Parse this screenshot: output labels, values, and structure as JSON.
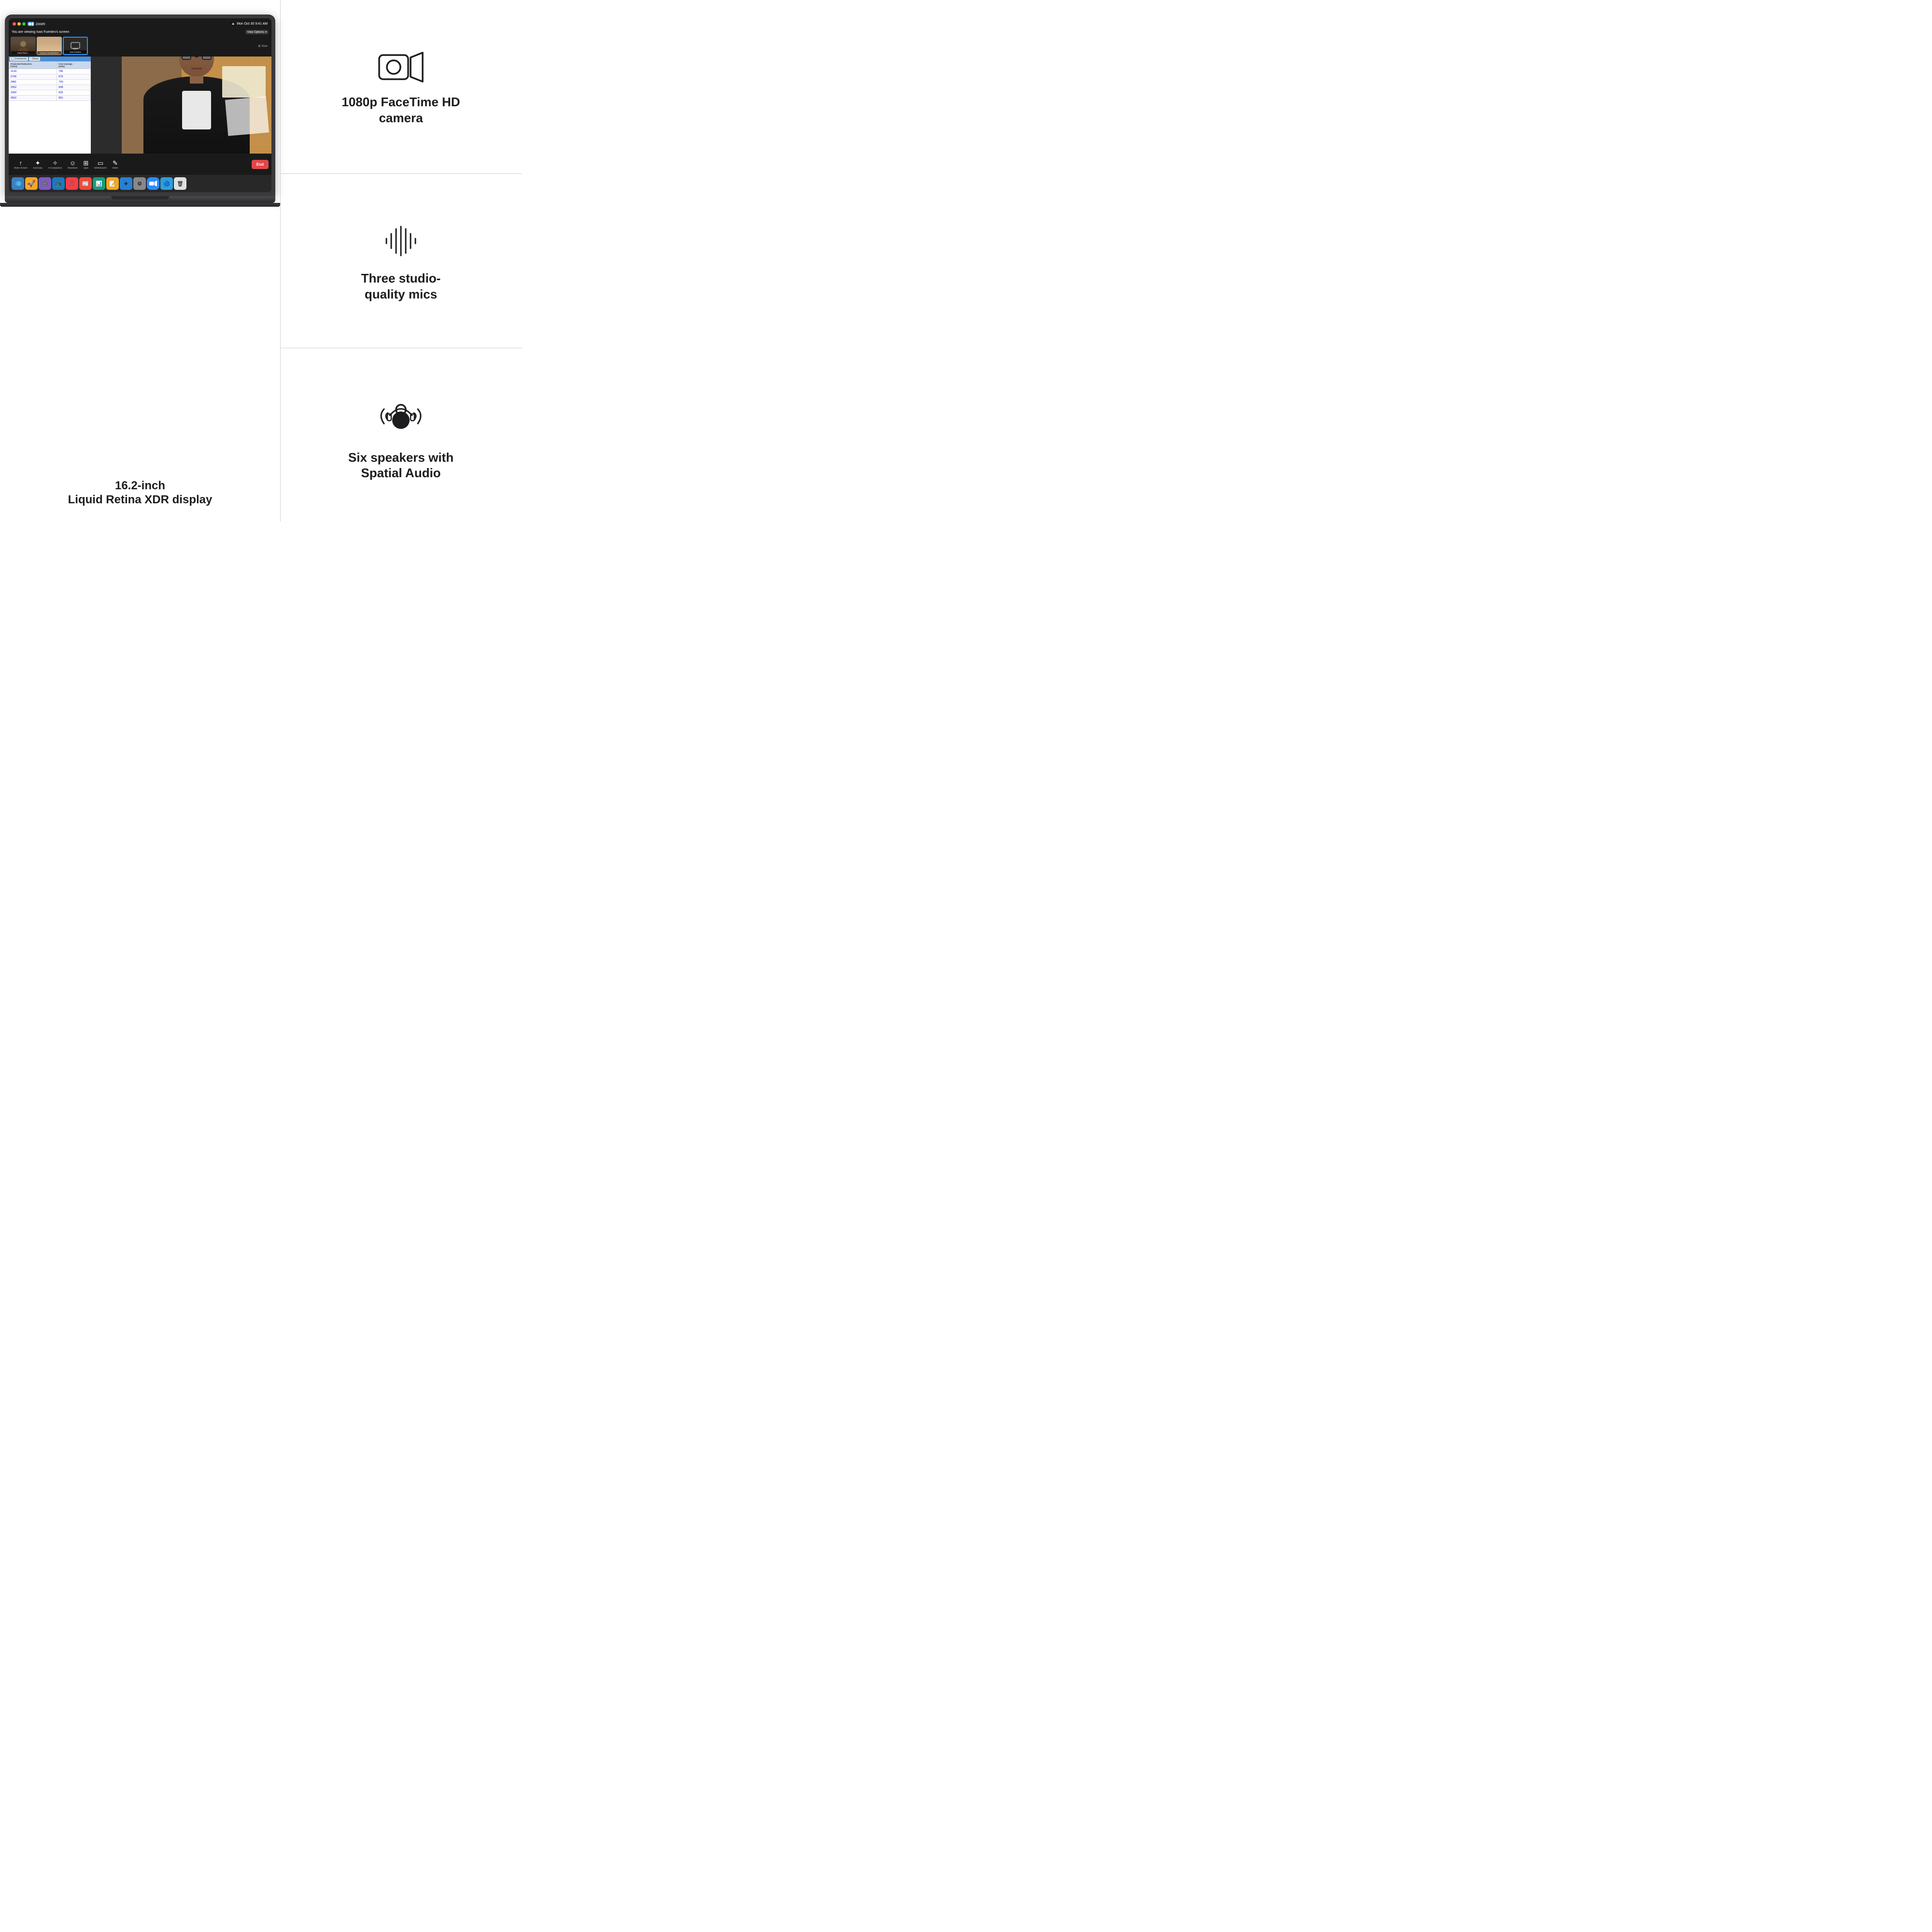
{
  "page": {
    "background": "#ffffff"
  },
  "laptop": {
    "screen": {
      "topbar": {
        "time": "Mon Oct 30  9:41 AM",
        "app": "zoom"
      },
      "viewing_banner": "You are viewing Ivan Fuentes's screen",
      "view_options": "View Options",
      "participants": [
        {
          "name": "David Beau...",
          "active": false
        },
        {
          "name": "Carmen Sharafeldeen",
          "active": false
        },
        {
          "name": "Ivan Fuentes",
          "active": true
        }
      ],
      "spreadsheet": {
        "toolbar_items": [
          "Comments",
          "Share"
        ],
        "header_row": [
          "Projected Reduction (Time)",
          "Cost Savings (USD)"
        ],
        "rows": [
          [
            "3143",
            "786"
          ],
          [
            "2706",
            "676"
          ],
          [
            "2881",
            "720"
          ],
          [
            "3352",
            "838"
          ],
          [
            "3300",
            "825"
          ],
          [
            "3562",
            "891"
          ]
        ]
      },
      "toolbar": {
        "items": [
          {
            "icon": "↑",
            "label": "Share Screen"
          },
          {
            "icon": "✦",
            "label": "Summary"
          },
          {
            "icon": "✧",
            "label": "AI Companion"
          },
          {
            "icon": "☺",
            "label": "Reactions"
          },
          {
            "icon": "⊞",
            "label": "Apps"
          },
          {
            "icon": "▭",
            "label": "Whiteboards"
          },
          {
            "icon": "✎",
            "label": "Notes"
          }
        ],
        "end_button": "End"
      }
    }
  },
  "caption_left": {
    "line1": "16.2-inch",
    "line2": "Liquid Retina XDR display"
  },
  "features": [
    {
      "id": "camera",
      "icon_type": "camera",
      "title": "1080p FaceTime HD\ncamera"
    },
    {
      "id": "mic",
      "icon_type": "mic",
      "title": "Three studio-\nquality mics"
    },
    {
      "id": "speaker",
      "icon_type": "speaker",
      "title": "Six speakers with\nSpatial Audio"
    }
  ]
}
